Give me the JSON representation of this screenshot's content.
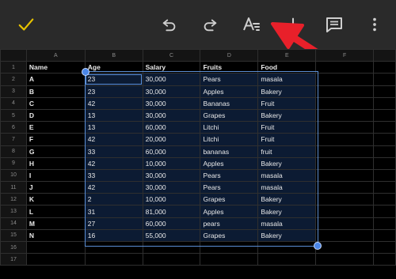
{
  "toolbar": {
    "buttons": [
      {
        "name": "confirm-check-icon"
      },
      {
        "name": "undo-icon"
      },
      {
        "name": "redo-icon"
      },
      {
        "name": "text-format-icon"
      },
      {
        "name": "insert-plus-icon"
      },
      {
        "name": "comment-icon"
      },
      {
        "name": "more-vertical-icon"
      }
    ],
    "accent_color": "#e6c200",
    "annotation_arrow_color": "#e8202a"
  },
  "sheet": {
    "columns": [
      "A",
      "B",
      "C",
      "D",
      "E",
      "F"
    ],
    "row_numbers": [
      "1",
      "2",
      "3",
      "4",
      "5",
      "6",
      "7",
      "8",
      "9",
      "10",
      "11",
      "12",
      "13",
      "14",
      "15",
      "16",
      "17"
    ],
    "header": [
      "Name",
      "Age",
      "Salary",
      "Fruits",
      "Food"
    ],
    "rows": [
      [
        "A",
        "23",
        "30,000",
        "Pears",
        "masala"
      ],
      [
        "B",
        "23",
        "30,000",
        "Apples",
        "Bakery"
      ],
      [
        "C",
        "42",
        "30,000",
        "Bananas",
        "Fruit"
      ],
      [
        "D",
        "13",
        "30,000",
        "Grapes",
        "Bakery"
      ],
      [
        "E",
        "13",
        "60,000",
        "Litchi",
        "Fruit"
      ],
      [
        "F",
        "42",
        "20,000",
        "Litchi",
        "Fruit"
      ],
      [
        "G",
        "33",
        "60,000",
        "bananas",
        "fruit"
      ],
      [
        "H",
        "42",
        "10,000",
        "Apples",
        "Bakery"
      ],
      [
        "I",
        "33",
        "30,000",
        "Pears",
        "masala"
      ],
      [
        "J",
        "42",
        "30,000",
        "Pears",
        "masala"
      ],
      [
        "K",
        "2",
        "10,000",
        "Grapes",
        "Bakery"
      ],
      [
        "L",
        "31",
        "81,000",
        "Apples",
        "Bakery"
      ],
      [
        "M",
        "27",
        "60,000",
        "pears",
        "masala"
      ],
      [
        "N",
        "16",
        "55,000",
        "Grapes",
        "Bakery"
      ]
    ],
    "selection_color": "#5b8fd6"
  }
}
